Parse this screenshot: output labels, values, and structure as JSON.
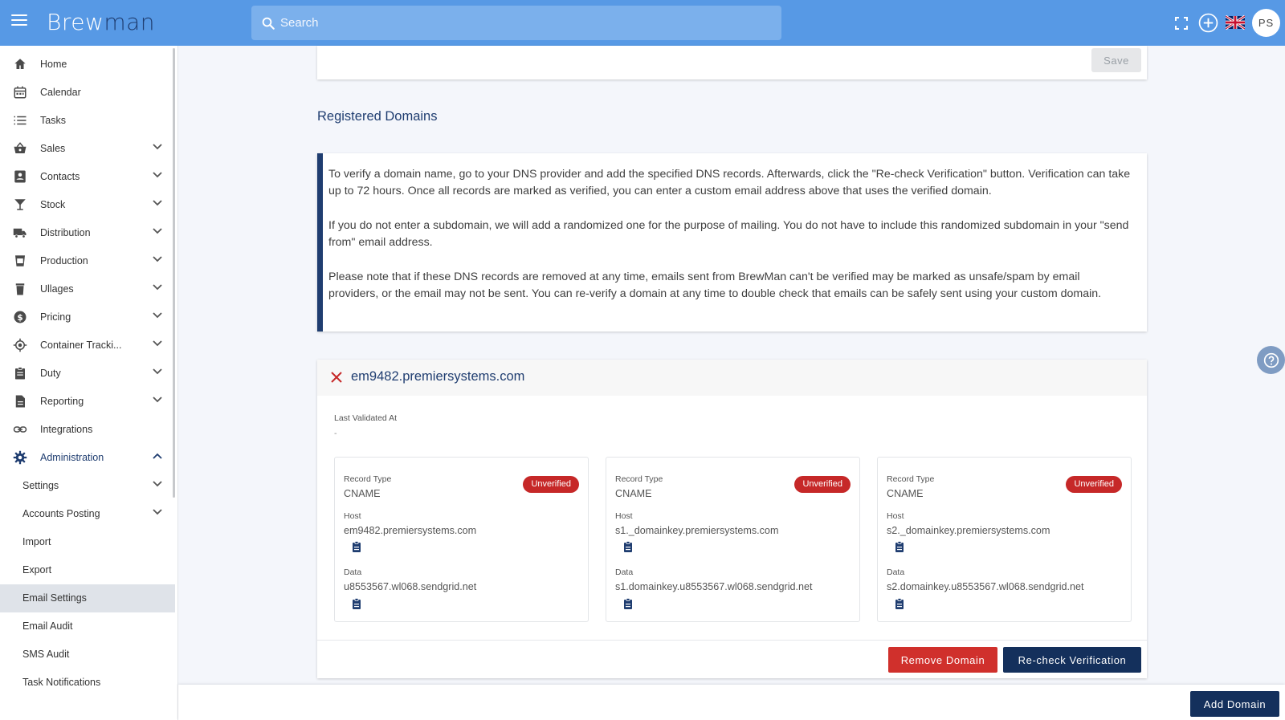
{
  "app": {
    "logo_main": "Brew",
    "logo_accent": "man"
  },
  "topbar": {
    "search_placeholder": "Search",
    "avatar_initials": "PS"
  },
  "sidebar": {
    "items": [
      {
        "label": "Home",
        "icon": "home-icon"
      },
      {
        "label": "Calendar",
        "icon": "calendar-icon"
      },
      {
        "label": "Tasks",
        "icon": "list-icon"
      },
      {
        "label": "Sales",
        "icon": "basket-icon"
      },
      {
        "label": "Contacts",
        "icon": "contacts-icon"
      },
      {
        "label": "Stock",
        "icon": "glass-icon"
      },
      {
        "label": "Distribution",
        "icon": "truck-icon"
      },
      {
        "label": "Production",
        "icon": "cup-icon"
      },
      {
        "label": "Ullages",
        "icon": "bin-icon"
      },
      {
        "label": "Pricing",
        "icon": "dollar-icon"
      },
      {
        "label": "Container Tracki...",
        "icon": "target-icon"
      },
      {
        "label": "Duty",
        "icon": "clipboard-icon"
      },
      {
        "label": "Reporting",
        "icon": "document-icon"
      },
      {
        "label": "Integrations",
        "icon": "link-icon"
      },
      {
        "label": "Administration",
        "icon": "gear-icon"
      }
    ],
    "sub_items": [
      {
        "label": "Settings"
      },
      {
        "label": "Accounts Posting"
      },
      {
        "label": "Import"
      },
      {
        "label": "Export"
      },
      {
        "label": "Email Settings"
      },
      {
        "label": "Email Audit"
      },
      {
        "label": "SMS Audit"
      },
      {
        "label": "Task Notifications"
      }
    ]
  },
  "main": {
    "save_label": "Save",
    "section_title": "Registered Domains",
    "info": [
      "To verify a domain name, go to your DNS provider and add the specified DNS records. Afterwards, click the \"Re-check Verification\" button. Verification can take up to 72 hours. Once all records are marked as verified, you can enter a custom email address above that uses the verified domain.",
      "If you do not enter a subdomain, we will add a randomized one for the purpose of mailing. You do not have to include this randomized subdomain in your \"send from\" email address.",
      "Please note that if these DNS records are removed at any time, emails sent from BrewMan can't be verified may be marked as unsafe/spam by email providers, or the email may not be sent. You can re-verify a domain at any time to double check that emails can be safely sent using your custom domain."
    ],
    "domain": {
      "name": "em9482.premiersystems.com",
      "last_validated_label": "Last Validated At",
      "last_validated_value": "-",
      "records": [
        {
          "type_label": "Record Type",
          "type": "CNAME",
          "status": "Unverified",
          "host_label": "Host",
          "host": "em9482.premiersystems.com",
          "data_label": "Data",
          "data": "u8553567.wl068.sendgrid.net"
        },
        {
          "type_label": "Record Type",
          "type": "CNAME",
          "status": "Unverified",
          "host_label": "Host",
          "host": "s1._domainkey.premiersystems.com",
          "data_label": "Data",
          "data": "s1.domainkey.u8553567.wl068.sendgrid.net"
        },
        {
          "type_label": "Record Type",
          "type": "CNAME",
          "status": "Unverified",
          "host_label": "Host",
          "host": "s2._domainkey.premiersystems.com",
          "data_label": "Data",
          "data": "s2.domainkey.u8553567.wl068.sendgrid.net"
        }
      ],
      "remove_label": "Remove Domain",
      "recheck_label": "Re-check Verification"
    },
    "add_domain_label": "Add Domain"
  },
  "colors": {
    "topbar": "#5799e5",
    "navy": "#1f3d70",
    "button_dark": "#14305c",
    "danger": "#c62828"
  }
}
